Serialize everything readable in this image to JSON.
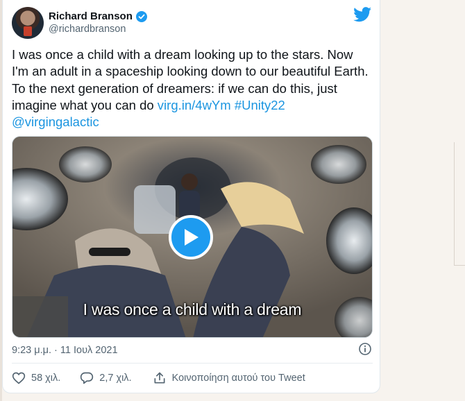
{
  "user": {
    "display_name": "Richard Branson",
    "handle": "@richardbranson",
    "verified": true
  },
  "tweet": {
    "text": "I was once a child with a dream looking up to the stars. Now I'm an adult in a spaceship looking down to our beautiful Earth. To the next generation of dreamers: if we can do this, just imagine what you can do ",
    "link": "virg.in/4wYm",
    "hashtag": "#Unity22",
    "mention": "@virgingalactic"
  },
  "media": {
    "type": "video",
    "caption": "I was once a child with a dream"
  },
  "meta": {
    "timestamp": "9:23 μ.μ. · 11 Ιουλ 2021"
  },
  "actions": {
    "likes": "58 χιλ.",
    "replies": "2,7 χιλ.",
    "share": "Κοινοποίηση αυτού του Tweet"
  },
  "colors": {
    "accent": "#1d9bf0",
    "link": "#1b95e0",
    "text": "#0f1419",
    "muted": "#536471",
    "page_background": "#f7f3ee"
  },
  "icons": [
    "twitter-bird-icon",
    "verified-badge-icon",
    "play-icon",
    "info-icon",
    "heart-icon",
    "reply-icon",
    "share-icon"
  ]
}
